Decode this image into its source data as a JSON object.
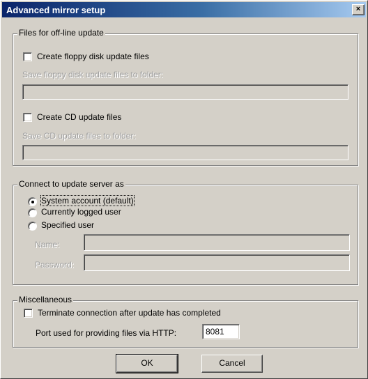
{
  "window": {
    "title": "Advanced mirror setup",
    "close_glyph": "×"
  },
  "offline": {
    "label": "Files for off-line update",
    "floppy_checkbox": "Create floppy disk update files",
    "floppy_folder_label": "Save floppy disk update files to folder:",
    "floppy_folder_value": "",
    "cd_checkbox": "Create CD update files",
    "cd_folder_label": "Save CD update files to folder:",
    "cd_folder_value": ""
  },
  "connect": {
    "label": "Connect to update server as",
    "options": [
      "System account (default)",
      "Currently logged user",
      "Specified user"
    ],
    "selected": "System account (default)",
    "name_label": "Name:",
    "name_value": "",
    "password_label": "Password:",
    "password_value": ""
  },
  "misc": {
    "label": "Miscellaneous",
    "terminate_checkbox": "Terminate connection after update has completed",
    "port_label": "Port used for providing files via HTTP:",
    "port_value": "8081"
  },
  "buttons": {
    "ok": "OK",
    "cancel": "Cancel"
  }
}
